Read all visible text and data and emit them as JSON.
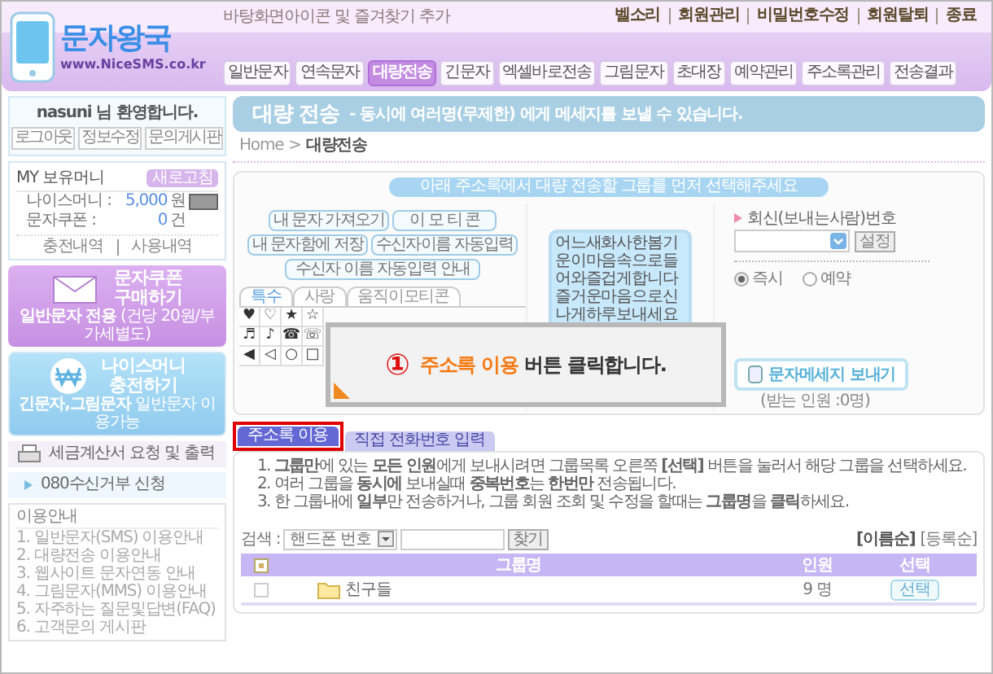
{
  "header": {
    "logo_title": "문자왕국",
    "logo_url": "www.NiceSMS.co.kr",
    "bookmark_link": "바탕화면아이콘 및 즐겨찾기 추가",
    "top_links": [
      "벨소리",
      "회원관리",
      "비밀번호수정",
      "회원탈퇴",
      "종료"
    ],
    "nav": [
      {
        "label": "일반문자",
        "selected": false
      },
      {
        "label": "연속문자",
        "selected": false
      },
      {
        "label": "대량전송",
        "selected": true
      },
      {
        "label": "긴문자",
        "selected": false
      },
      {
        "label": "엑셀바로전송",
        "selected": false
      },
      {
        "label": "그림문자",
        "selected": false
      },
      {
        "label": "초대장",
        "selected": false
      },
      {
        "label": "예약관리",
        "selected": false
      },
      {
        "label": "주소록관리",
        "selected": false
      },
      {
        "label": "전송결과",
        "selected": false
      }
    ]
  },
  "sidebar": {
    "welcome": "nasuni 님 환영합니다.",
    "account_buttons": [
      "로그아웃",
      "정보수정",
      "문의게시판"
    ],
    "money": {
      "title": "MY 보유머니",
      "refresh": "새로고침",
      "rows": [
        {
          "label": "나이스머니 :",
          "value": "5,000",
          "unit": "원",
          "has_detail": true
        },
        {
          "label": "문자쿠폰 :",
          "value": "0",
          "unit": "건",
          "has_detail": false
        }
      ],
      "links": [
        "충전내역",
        "사용내역"
      ]
    },
    "banners": [
      {
        "kind": "coupon",
        "title_lines": [
          "문자쿠폰",
          "구매하기"
        ],
        "note": "**일반문자 전용** (건당 20원/부가세별도)"
      },
      {
        "kind": "money",
        "title_lines": [
          "나이스머니",
          "충전하기"
        ],
        "note": "**긴문자,그림문자** 일반문자 이용가능"
      }
    ],
    "menu": [
      {
        "kind": "tax",
        "label": "세금계산서 요청 및 출력"
      },
      {
        "kind": "link",
        "label": "080수신거부 신청"
      }
    ],
    "guide": {
      "title": "이용안내",
      "items": [
        "1. 일반문자(SMS) 이용안내",
        "2. 대량전송 이용안내",
        "3. 웹사이트 문자연동 안내",
        "4. 그림문자(MMS) 이용안내",
        "5. 자주하는 질문및답변(FAQ)",
        "6. 고객문의 게시판"
      ]
    }
  },
  "page_title": {
    "title": "대량 전송",
    "subtitle": "- 동시에 여러명(무제한) 에게 메세지를 보낼 수 있습니다."
  },
  "breadcrumb": {
    "home": "Home",
    "separator": ">",
    "current": "대량전송"
  },
  "compose": {
    "notice": "아래 주소록에서 대량 전송할 그룹를 먼저 선택해주세요",
    "tool_buttons": [
      "내 문자 가져오기",
      "이 모 티 콘",
      "내 문자함에 저장",
      "수신자이름 자동입력",
      "수신자 이름 자동입력 안내"
    ],
    "emoticon_tabs": [
      {
        "label": "특수",
        "selected": true
      },
      {
        "label": "사랑",
        "selected": false
      },
      {
        "label": "움직이모티콘",
        "selected": false
      }
    ],
    "emoticons": [
      "♥",
      "♡",
      "★",
      "☆",
      "♬",
      "♪",
      "☎",
      "☏",
      "◀",
      "◁",
      "○",
      "□"
    ],
    "message": "어느새화사한봄기운이마음속으로들어와즐겁게합니다즐거운마음으로신나게하루보내세요",
    "reply_label": "회신(보내는사람)번호",
    "set_button": "설정",
    "send_timing": [
      {
        "label": "즉시",
        "selected": true
      },
      {
        "label": "예약",
        "selected": false
      }
    ],
    "send_button": "문자메세지 보내기",
    "recipient_count": "(받는 인원 :0명)"
  },
  "tip": {
    "step": "①",
    "text": "**주소록 이용** 버튼 클릭합니다."
  },
  "recipient_tabs": [
    {
      "label": "주소록 이용",
      "selected": true,
      "highlighted": true
    },
    {
      "label": "직접 전화번호 입력",
      "selected": false,
      "highlighted": false
    }
  ],
  "instructions": [
    "1. **그룹만**에 있는 **모든 인원**에게 보내시려면 그룹목록 오른쪽 **[선택]** 버튼을 눌러서 해당 그룹을 선택하세요.",
    "2. 여러 그룹을 **동시에** 보내실때 **중복번호**는 **한번만** 전송됩니다.",
    "3. 한 그룹내에 **일부**만 전송하거나, 그룹 회원 조회 및 수정을 할때는 **그룹명**을 **클릭**하세요."
  ],
  "search": {
    "label": "검색 :",
    "field": "핸드폰 번호",
    "button": "찾기",
    "sorts": [
      {
        "label": "[이름순]",
        "selected": true
      },
      {
        "label": "[등록순]",
        "selected": false
      }
    ]
  },
  "group_table": {
    "columns": [
      "그룹명",
      "인원",
      "선택"
    ],
    "all_checked": true,
    "rows": [
      {
        "name": "친구들",
        "count": "9 명",
        "checked": false,
        "action": "선택"
      }
    ]
  }
}
